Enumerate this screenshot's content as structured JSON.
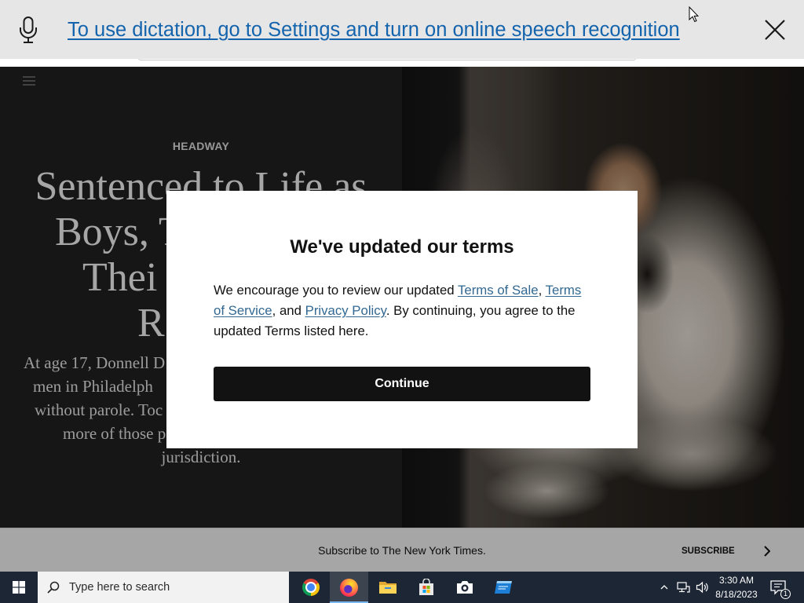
{
  "dictation_bar": {
    "icon": "microphone-icon",
    "message": "To use dictation, go to Settings and turn on online speech recognition",
    "close_icon": "close-icon"
  },
  "article": {
    "menu_icon": "hamburger-menu-icon",
    "section_label": "HEADWAY",
    "headline_lines": [
      "Sentenced to Life as",
      "Boys, T",
      "Thei",
      "R"
    ],
    "summary_lines": [
      "At age 17, Donnell D",
      "men in Philadelph",
      "without parole. Toc",
      "more of those p",
      "jurisdiction."
    ]
  },
  "terms_modal": {
    "title": "We've updated our terms",
    "text_before_links": "We encourage you to review our updated ",
    "terms_of_sale_link": "Terms of Sale",
    "separator_1": ", ",
    "terms_of_service_link": "Terms of Service",
    "separator_2": ", and ",
    "privacy_policy_link": "Privacy Policy",
    "text_after_links": ". By continuing, you agree to the updated Terms listed here.",
    "continue_button": "Continue"
  },
  "subscribe_bar": {
    "message": "Subscribe to The New York Times.",
    "cta_label": "SUBSCRIBE",
    "cta_icon": "chevron-right-icon"
  },
  "taskbar": {
    "start_icon": "windows-start-icon",
    "search_icon": "search-icon",
    "search_placeholder": "Type here to search",
    "pinned_apps": [
      {
        "icon": "chrome-icon",
        "active": false
      },
      {
        "icon": "firefox-icon",
        "active": true
      },
      {
        "icon": "file-explorer-icon",
        "active": false
      },
      {
        "icon": "microsoft-store-icon",
        "active": false
      },
      {
        "icon": "camera-icon",
        "active": false
      },
      {
        "icon": "app-window-icon",
        "active": false
      }
    ],
    "tray_icons": [
      "show-hidden-icons-icon",
      "network-icon",
      "volume-icon"
    ],
    "clock_time": "3:30 AM",
    "clock_date": "8/18/2023",
    "action_center_icon": "notifications-icon",
    "notification_count": "1"
  },
  "screen": {
    "pointer_icon": "mouse-pointer-icon"
  },
  "colors": {
    "dictation_link": "#1464ad",
    "terms_link": "#326891",
    "continue_button": "#121212",
    "taskbar": "#1c2634",
    "modal_backdrop": "rgba(0,0,0,0.35)"
  }
}
